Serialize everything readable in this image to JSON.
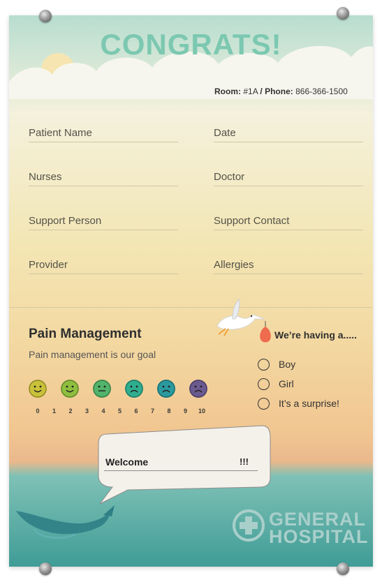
{
  "title": "CONGRATS!",
  "room": {
    "room_label": "Room:",
    "room_value": "#1A",
    "sep": "/",
    "phone_label": "Phone:",
    "phone_value": "866-366-1500"
  },
  "fields": {
    "patient_name": "Patient Name",
    "date": "Date",
    "nurses": "Nurses",
    "doctor": "Doctor",
    "support_person": "Support Person",
    "support_contact": "Support Contact",
    "provider": "Provider",
    "allergies": "Allergies"
  },
  "pain": {
    "title": "Pain Management",
    "subtitle": "Pain management is our goal",
    "scale": [
      "0",
      "1",
      "2",
      "3",
      "4",
      "5",
      "6",
      "7",
      "8",
      "9",
      "10"
    ],
    "face_colors": [
      "#c9c13a",
      "#8fbe3f",
      "#52b36a",
      "#2fae8f",
      "#2a9a9e",
      "#6b5a8f"
    ]
  },
  "having": {
    "title": "We’re having a.....",
    "options": [
      "Boy",
      "Girl",
      "It’s a surprise!"
    ]
  },
  "welcome": {
    "label": "Welcome",
    "suffix": "!!!"
  },
  "hospital": {
    "line1": "GENERAL",
    "line2": "HOSPITAL"
  },
  "icons": [
    "stork-icon",
    "baby-bundle-icon",
    "smiley-face-icon",
    "whale-icon",
    "hospital-cross-icon",
    "speech-bubble-icon"
  ]
}
